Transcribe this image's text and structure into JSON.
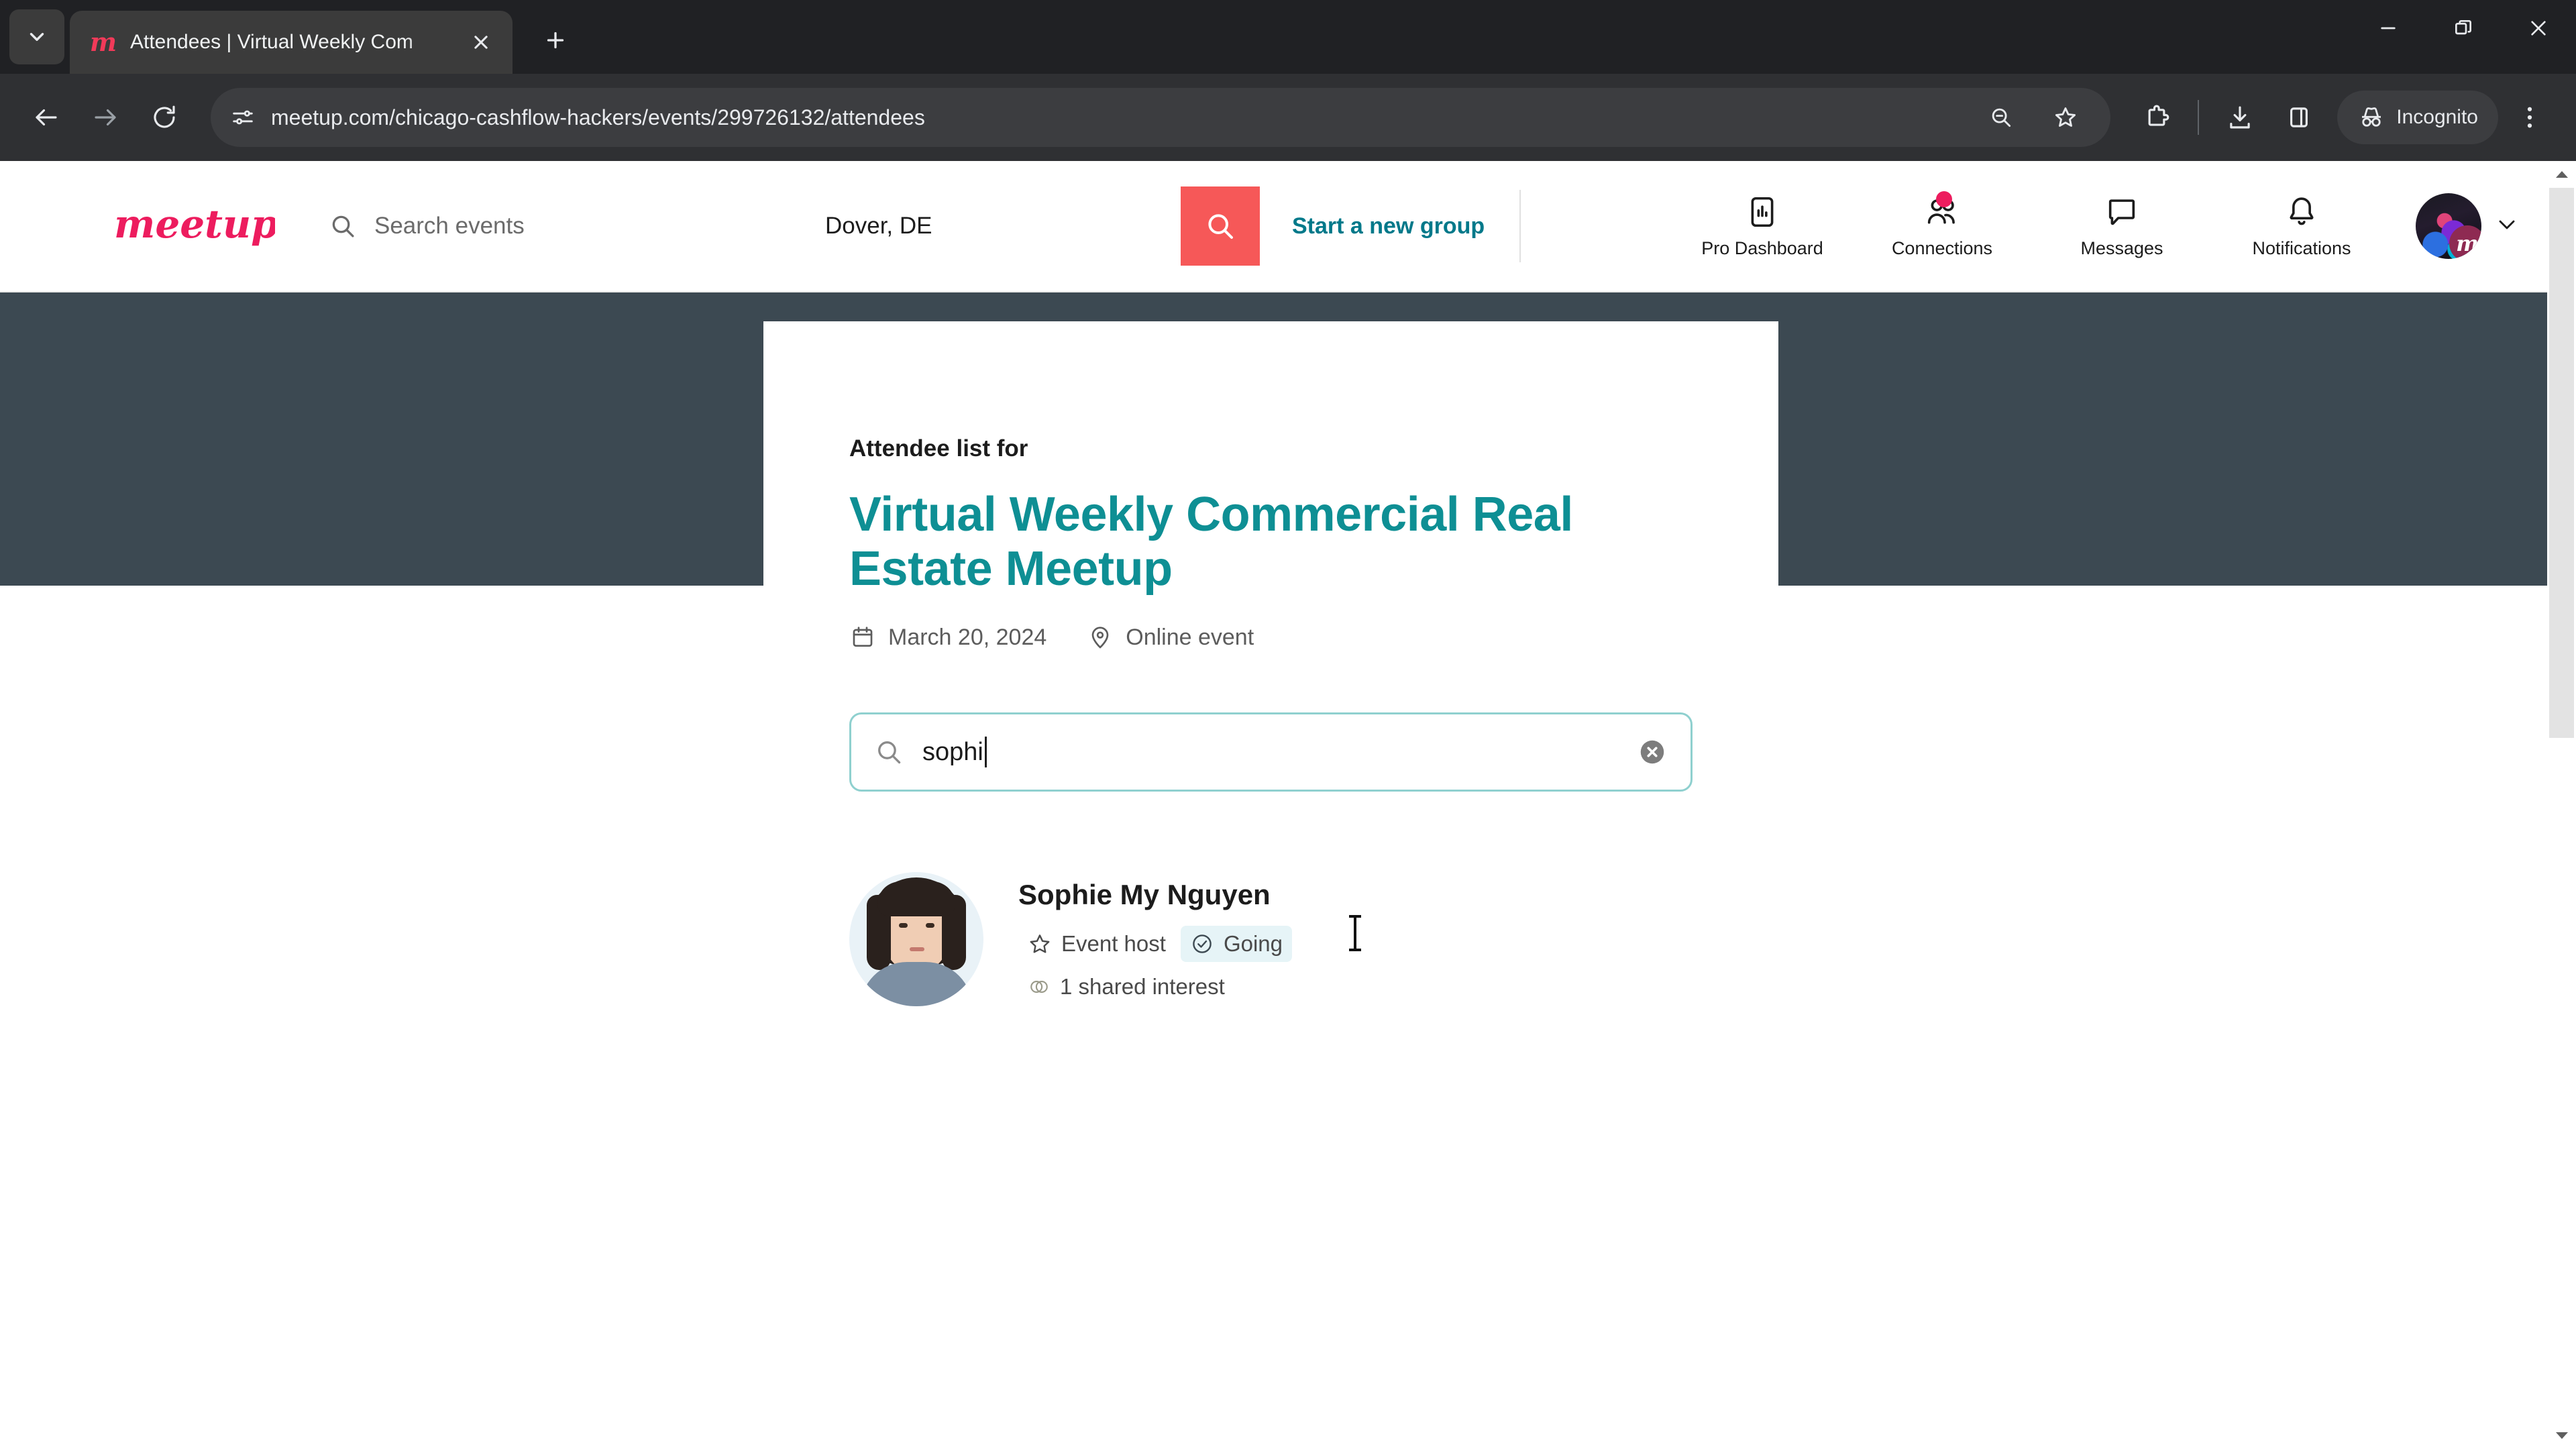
{
  "browser": {
    "tab": {
      "title": "Attendees | Virtual Weekly Com",
      "favicon_icon": "meetup-m-icon",
      "close_icon": "close-icon"
    },
    "tablist_icon": "chevron-down-icon",
    "newtab_icon": "plus-icon",
    "window_controls": {
      "minimize_icon": "minimize-icon",
      "maximize_icon": "restore-icon",
      "close_icon": "close-icon"
    },
    "toolbar": {
      "back_icon": "arrow-left-icon",
      "forward_icon": "arrow-right-icon",
      "reload_icon": "reload-icon",
      "site_info_icon": "tune-icon",
      "url": "meetup.com/chicago-cashflow-hackers/events/299726132/attendees",
      "zoom_icon": "zoom-out-icon",
      "bookmark_icon": "star-icon",
      "extensions_icon": "puzzle-icon",
      "downloads_icon": "download-icon",
      "side_panel_icon": "side-panel-icon",
      "incognito_label": "Incognito",
      "incognito_icon": "incognito-icon",
      "menu_icon": "three-dot-menu-icon"
    }
  },
  "site": {
    "logo_text": "meetup",
    "search": {
      "placeholder": "Search events",
      "value": "",
      "icon": "search-icon"
    },
    "location": {
      "placeholder": "Location",
      "value": "Dover, DE"
    },
    "search_button_icon": "search-icon",
    "start_group_label": "Start a new group",
    "nav": [
      {
        "label": "Pro Dashboard",
        "icon": "bar-chart-icon",
        "badge": false
      },
      {
        "label": "Connections",
        "icon": "people-icon",
        "badge": true
      },
      {
        "label": "Messages",
        "icon": "chat-bubble-icon",
        "badge": false
      },
      {
        "label": "Notifications",
        "icon": "bell-icon",
        "badge": false
      }
    ],
    "avatar": {
      "badge_letter": "m",
      "chevron_icon": "chevron-down-icon"
    }
  },
  "main": {
    "eyebrow": "Attendee list for",
    "title": "Virtual Weekly Commercial Real Estate Meetup",
    "meta": [
      {
        "icon": "calendar-icon",
        "text": "March 20, 2024"
      },
      {
        "icon": "location-pin-icon",
        "text": "Online event"
      }
    ],
    "attendee_search": {
      "value": "sophi",
      "placeholder": "Search attendees",
      "icon": "search-icon",
      "clear_icon": "clear-circle-icon"
    },
    "attendees": [
      {
        "name": "Sophie My Nguyen",
        "host_label": "Event host",
        "host_icon": "star-icon",
        "rsvp_label": "Going",
        "rsvp_icon": "check-circle-icon",
        "shared_label": "1 shared interest",
        "shared_icon": "venn-diagram-icon"
      }
    ]
  },
  "colors": {
    "brand_pink": "#f13a59",
    "search_button": "#f65858",
    "teal": "#0e8f94",
    "link_teal": "#00798a",
    "hero_band": "#3c4952",
    "going_badge_bg": "#e6f4f7",
    "badge_dot": "#ed1c5e"
  },
  "scrollbar": {
    "up_icon": "triangle-up-icon",
    "down_icon": "triangle-down-icon"
  }
}
